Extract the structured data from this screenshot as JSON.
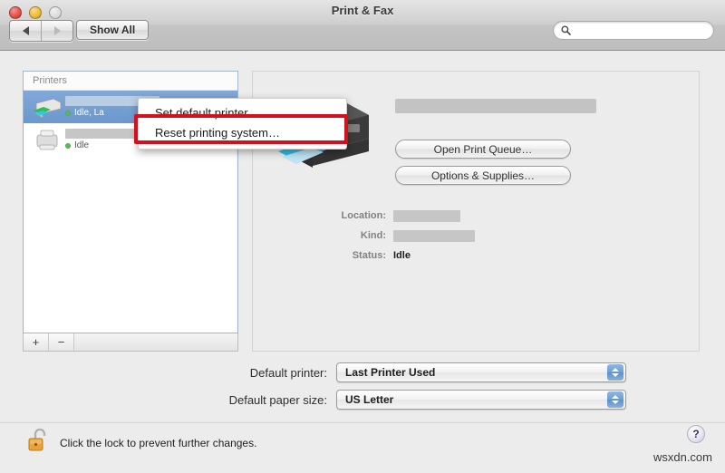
{
  "window": {
    "title": "Print & Fax",
    "traffic_lights": [
      "close-button",
      "minimize-button",
      "zoom-button"
    ]
  },
  "toolbar": {
    "back_icon": "back-arrow-icon",
    "forward_icon": "forward-arrow-icon",
    "show_all_label": "Show All",
    "search": {
      "icon": "search-icon",
      "value": "",
      "placeholder": ""
    }
  },
  "printers_list": {
    "header": "Printers",
    "items": [
      {
        "name": "",
        "name_redacted": true,
        "status": "Idle, La",
        "status_dot_color": "#5cb85c",
        "selected": true,
        "icon": "color-printer-icon"
      },
      {
        "name": "",
        "name_redacted": true,
        "status": "Idle",
        "status_dot_color": "#5cb85c",
        "selected": false,
        "icon": "gray-printer-icon"
      }
    ],
    "add_button": "+",
    "remove_button": "−"
  },
  "context_menu": {
    "items": [
      {
        "label": "Set default printer",
        "highlighted": false
      },
      {
        "label": "Reset printing system…",
        "highlighted": true
      }
    ],
    "highlight_color": "#d3101b"
  },
  "detail": {
    "printer_name_redacted": true,
    "printer_image": "inkjet-printer-illustration",
    "buttons": {
      "open_queue": "Open Print Queue…",
      "options_supplies": "Options & Supplies…"
    },
    "info": [
      {
        "label": "Location:",
        "value": "",
        "redacted": true,
        "redact_width": 74
      },
      {
        "label": "Kind:",
        "value": "",
        "redacted": true,
        "redact_width": 90
      },
      {
        "label": "Status:",
        "value": "Idle",
        "redacted": false,
        "redact_width": 0
      }
    ]
  },
  "defaults": {
    "printer_label": "Default printer:",
    "printer_value": "Last Printer Used",
    "paper_label": "Default paper size:",
    "paper_value": "US Letter"
  },
  "footer": {
    "lock_icon": "unlocked-padlock-icon",
    "lock_text": "Click the lock to prevent further changes.",
    "help_label": "?",
    "watermark": "wsxdn.com"
  }
}
